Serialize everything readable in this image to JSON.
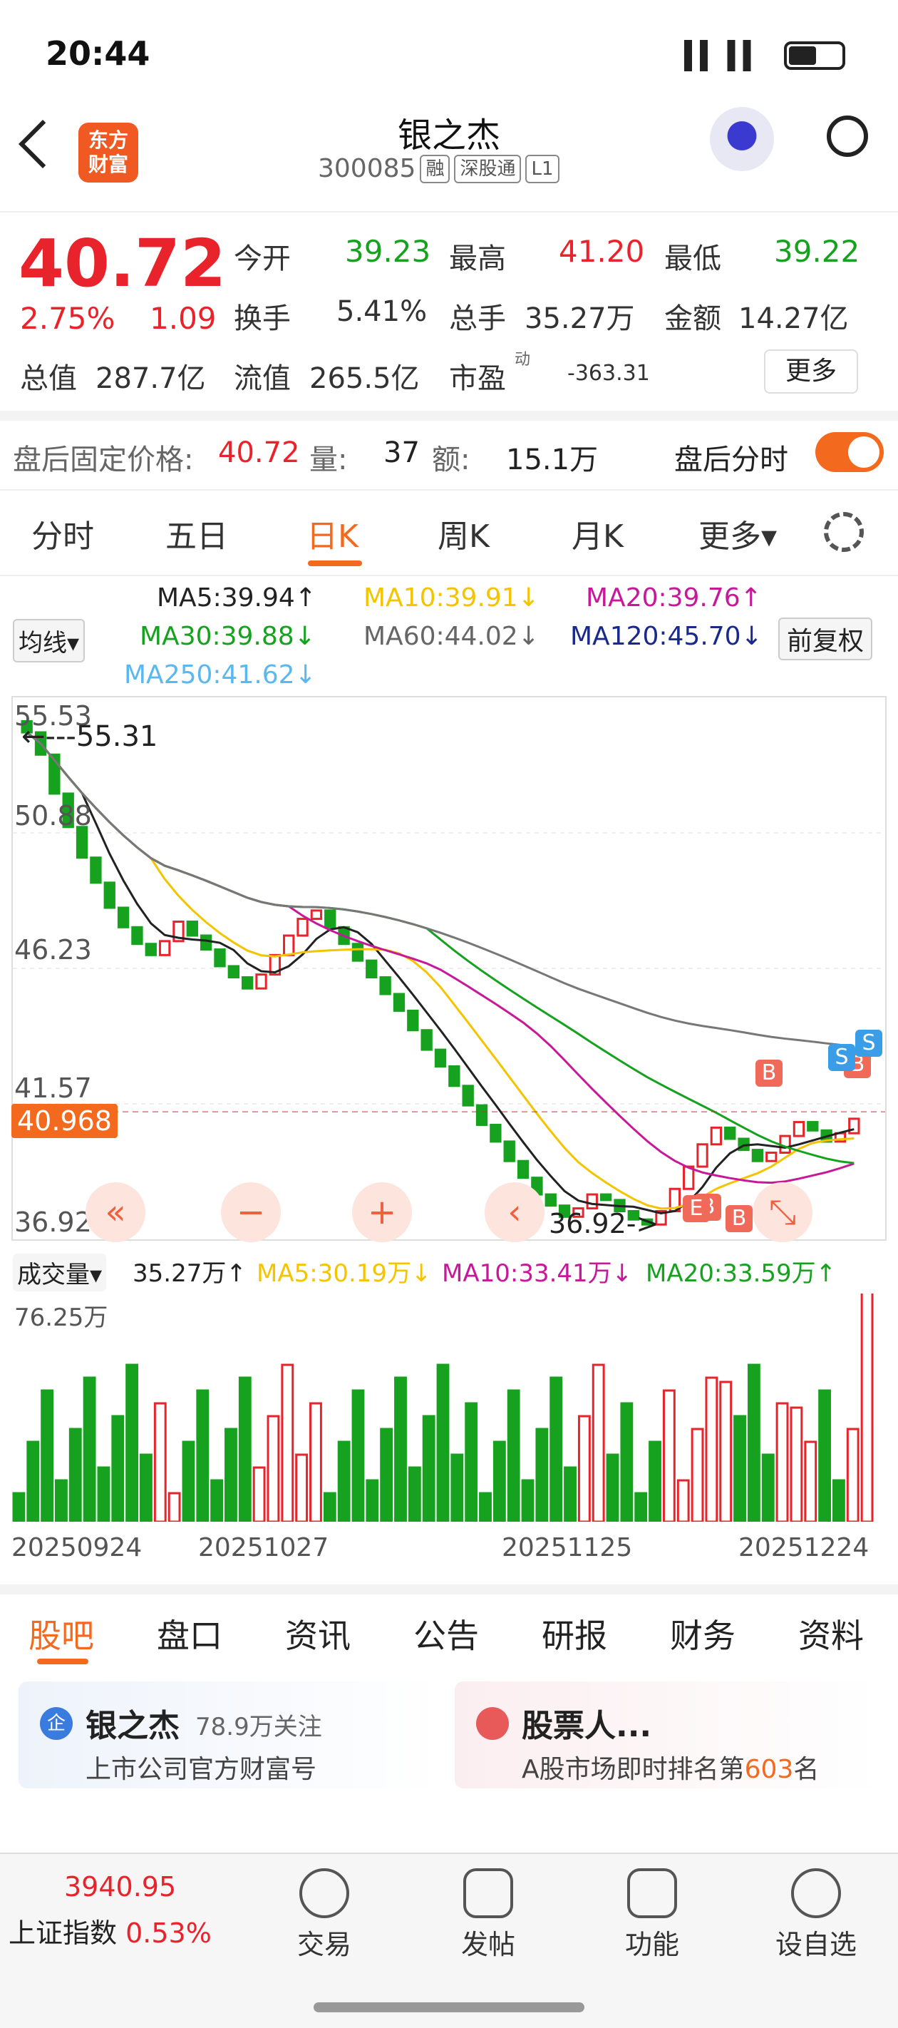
{
  "status": {
    "time": "20:44"
  },
  "header": {
    "logo_text": "东方\n财富",
    "title": "银之杰",
    "code": "300085",
    "tags": [
      "融",
      "深股通",
      "L1"
    ]
  },
  "quote": {
    "price": "40.72",
    "pct": "2.75%",
    "chg": "1.09",
    "open_l": "今开",
    "open": "39.23",
    "high_l": "最高",
    "high": "41.20",
    "low_l": "最低",
    "low": "39.22",
    "turn_l": "换手",
    "turn": "5.41%",
    "vol_l": "总手",
    "vol": "35.27万",
    "amt_l": "金额",
    "amt": "14.27亿",
    "cap_l": "总值",
    "cap": "287.7亿",
    "fcap_l": "流值",
    "fcap": "265.5亿",
    "pe_l": "市盈",
    "pe_sup": "动",
    "pe": "-363.31",
    "more": "更多"
  },
  "after": {
    "price_l": "盘后固定价格:",
    "price": "40.72",
    "vol_l": "量:",
    "vol": "37",
    "amt_l": "额:",
    "amt": "15.1万",
    "toggle_l": "盘后分时"
  },
  "tabs": [
    "分时",
    "五日",
    "日K",
    "周K",
    "月K",
    "更多▾"
  ],
  "ma": {
    "ma5": "MA5:39.94↑",
    "ma10": "MA10:39.91↓",
    "ma20": "MA20:39.76↑",
    "ma30": "MA30:39.88↓",
    "ma60": "MA60:44.02↓",
    "ma120": "MA120:45.70↓",
    "ma250": "MA250:41.62↓",
    "sel": "均线▾",
    "fq": "前复权"
  },
  "colors": {
    "ma5": "#f5c400",
    "ma10": "#c8189a",
    "ma20": "#16a21e",
    "ma60": "#777777",
    "ma120": "#1a2a8c",
    "ma250": "#5ab8f0",
    "up": "#e8232b",
    "down": "#16a21e"
  },
  "chart_data": {
    "type": "candlestick",
    "y_ticks": [
      "55.53",
      "50.88",
      "46.23",
      "41.57",
      "36.92"
    ],
    "high_label": "55.31",
    "low_label": "36.92",
    "last": "40.968",
    "x": [
      "20250924",
      "20251027",
      "20251125",
      "20251224"
    ],
    "closes": [
      54.6,
      53.8,
      52.4,
      51.2,
      50.1,
      49.2,
      48.3,
      47.6,
      47.0,
      46.6,
      47.1,
      47.8,
      47.3,
      46.8,
      46.2,
      45.8,
      45.4,
      45.9,
      46.6,
      47.3,
      47.9,
      48.2,
      47.6,
      47.0,
      46.4,
      45.8,
      45.2,
      44.6,
      43.9,
      43.2,
      42.6,
      41.9,
      41.2,
      40.5,
      39.9,
      39.2,
      38.6,
      38.0,
      37.6,
      37.2,
      37.5,
      38.0,
      37.8,
      37.4,
      37.1,
      36.92,
      37.4,
      38.2,
      39.0,
      39.8,
      40.4,
      40.0,
      39.6,
      39.2,
      39.5,
      40.1,
      40.6,
      40.3,
      39.9,
      40.2,
      40.72
    ],
    "volume": {
      "label": "成交量▾",
      "total": "35.27万↑",
      "ma5": "MA5:30.19万↓",
      "ma10": "MA10:33.41万↓",
      "ma20": "MA20:33.59万↑",
      "max": "76.25万"
    }
  },
  "sections": [
    "股吧",
    "盘口",
    "资讯",
    "公告",
    "研报",
    "财务",
    "资料"
  ],
  "cards": {
    "left_title": "银之杰",
    "left_follow": "78.9万关注",
    "left_sub": "上市公司官方财富号",
    "right_title": "股票人...",
    "right_sub_a": "A股市场即时排名第",
    "right_rank": "603",
    "right_sub_b": "名"
  },
  "nav": {
    "index_val": "3940.95",
    "index_name": "上证指数",
    "index_pct": "0.53%",
    "items": [
      "交易",
      "发帖",
      "功能",
      "设自选"
    ]
  }
}
